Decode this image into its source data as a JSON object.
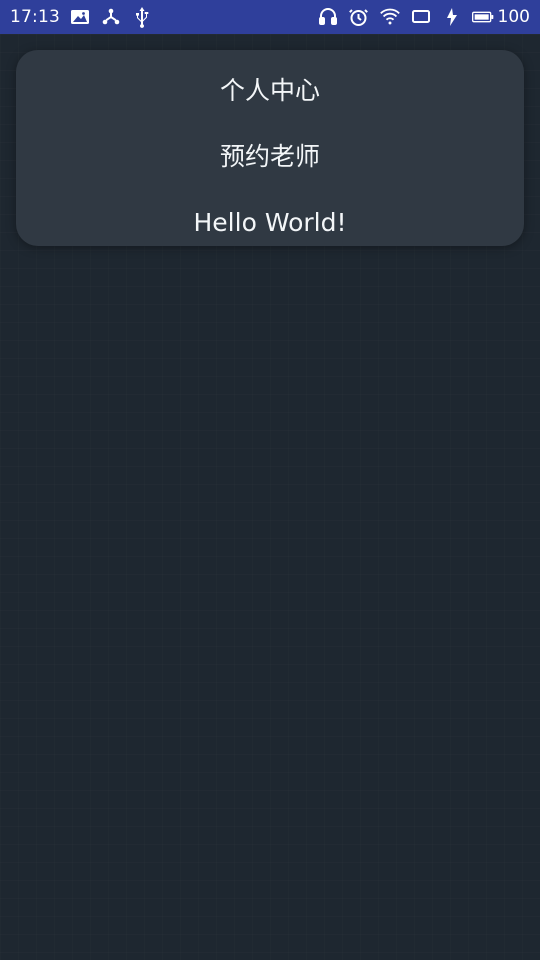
{
  "status_bar": {
    "time": "17:13",
    "battery_level": "100",
    "icons": [
      "image-icon",
      "share-icon",
      "usb-icon",
      "headphones-icon",
      "alarm-icon",
      "wifi-icon",
      "cast-icon",
      "charging-icon",
      "battery-icon"
    ]
  },
  "menu": {
    "items": [
      {
        "label": "个人中心"
      },
      {
        "label": "预约老师"
      },
      {
        "label": "Hello World!"
      }
    ]
  }
}
